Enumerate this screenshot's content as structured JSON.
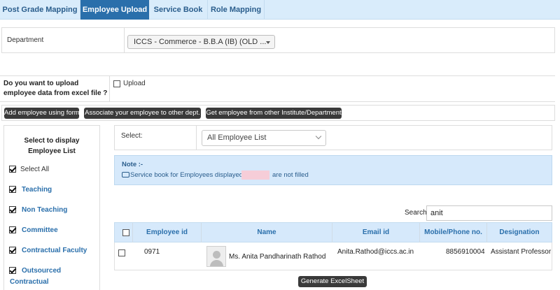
{
  "tabs": [
    {
      "label": "Post Grade Mapping",
      "active": false
    },
    {
      "label": "Employee Upload",
      "active": true
    },
    {
      "label": "Service Book",
      "active": false
    },
    {
      "label": "Role Mapping",
      "active": false
    }
  ],
  "department": {
    "label": "Department",
    "selected": "ICCS - Commerce - B.B.A (IB) (OLD ..."
  },
  "upload": {
    "question_line1": "Do you want to upload",
    "question_line2": "employee data from excel file ?",
    "checkbox_label": "Upload",
    "checked": false
  },
  "actions": {
    "add_form": "Add employee using form",
    "associate": "Associate your employee to other dept.",
    "get_other": "Get employee from other Institute/Department"
  },
  "filters": {
    "title_line1": "Select to display",
    "title_line2": "Employee List",
    "items": [
      {
        "label": "Select All",
        "checked": true
      },
      {
        "label": "Teaching",
        "checked": true
      },
      {
        "label": "Non Teaching",
        "checked": true
      },
      {
        "label": "Committee",
        "checked": true
      },
      {
        "label": "Contractual Faculty",
        "checked": true
      },
      {
        "label_line1": "Outsourced",
        "label_line2": "Contractual",
        "checked": true
      }
    ]
  },
  "list_select": {
    "label": "Select:",
    "selected": "All Employee List"
  },
  "note": {
    "title": "Note :-",
    "text_before": "Service book for Employees displayed in",
    "text_after": "are not filled",
    "highlight_color": "#f6cdd8"
  },
  "search": {
    "label": "Search:",
    "value": "anit"
  },
  "table": {
    "headers": {
      "employee_id": "Employee id",
      "name": "Name",
      "email": "Email id",
      "mobile": "Mobile/Phone no.",
      "designation": "Designation"
    },
    "rows": [
      {
        "employee_id": "0971",
        "name": "Ms. Anita Pandharinath Rathod",
        "email": "Anita.Rathod@iccs.ac.in",
        "mobile": "8856910004",
        "designation": "Assistant Professor"
      }
    ]
  },
  "generate_button": "Generate ExcelSheet",
  "colors": {
    "tab_active": "#2a6fab",
    "tab_bar": "#d9ecfb",
    "link_blue": "#2a6fab",
    "note_bg": "#d6e9fb"
  }
}
